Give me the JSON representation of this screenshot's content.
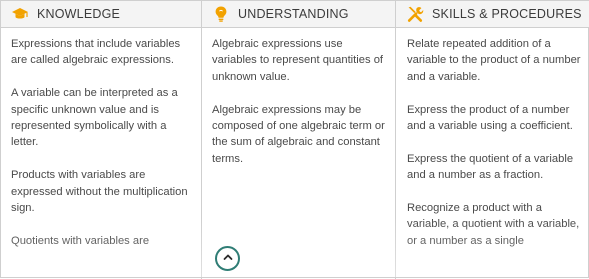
{
  "columns": [
    {
      "title": "KNOWLEDGE",
      "icon": "graduation-cap-icon",
      "icon_color": "#f2a200",
      "paragraphs": [
        "Expressions that include variables are called algebraic expressions.",
        "A variable can be interpreted as a specific unknown value and is represented symbolically with a letter.",
        "Products with variables are expressed without the multiplication sign.",
        "Quotients with variables are"
      ]
    },
    {
      "title": "UNDERSTANDING",
      "icon": "lightbulb-icon",
      "icon_color": "#f2a200",
      "paragraphs": [
        "Algebraic expressions use variables to represent quantities of unknown value.",
        "Algebraic expressions may be composed of one algebraic term or the sum of algebraic and constant terms."
      ]
    },
    {
      "title": "SKILLS & PROCEDURES",
      "icon": "tools-icon",
      "icon_color": "#f2a200",
      "paragraphs": [
        "Relate repeated addition of a variable to the product of a number and a variable.",
        "Express the product of a number and a variable using a coefficient.",
        "Express the quotient of a variable and a number as a fraction.",
        "Recognize a product with a variable, a quotient with a variable, or a number as a single"
      ]
    }
  ],
  "collapse_button": {
    "icon": "chevron-up-icon",
    "color": "#2f7d75"
  }
}
